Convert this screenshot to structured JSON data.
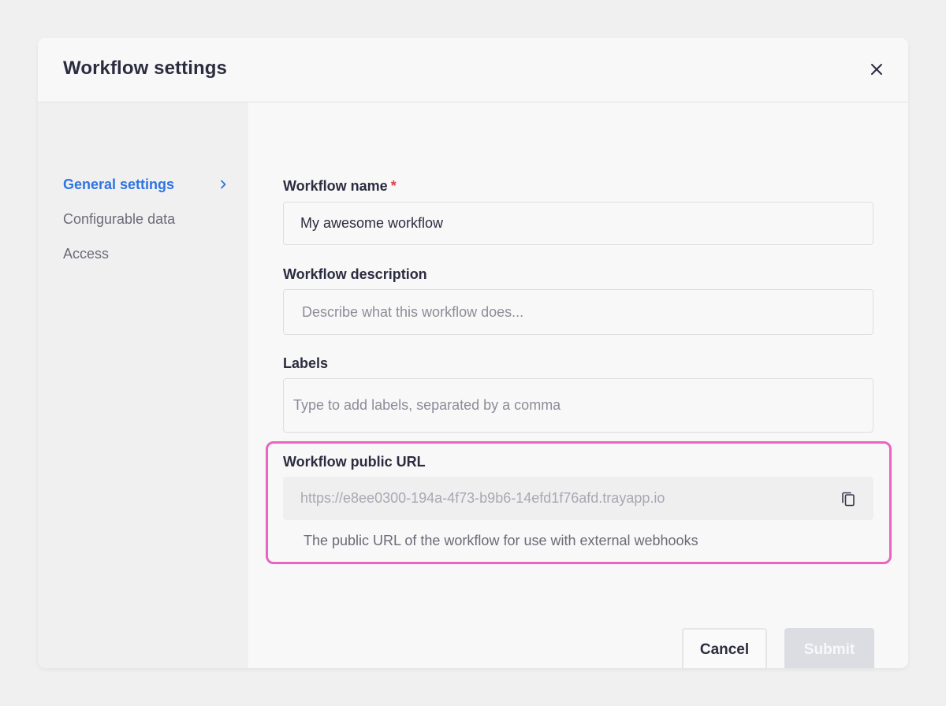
{
  "modal": {
    "title": "Workflow settings"
  },
  "sidebar": {
    "items": [
      {
        "label": "General settings",
        "active": true
      },
      {
        "label": "Configurable data",
        "active": false
      },
      {
        "label": "Access",
        "active": false
      }
    ]
  },
  "form": {
    "name": {
      "label": "Workflow name",
      "required_mark": "*",
      "value": "My awesome workflow"
    },
    "description": {
      "label": "Workflow description",
      "placeholder": "Describe what this workflow does..."
    },
    "labels": {
      "label": "Labels",
      "placeholder": "Type to add labels, separated by a comma"
    },
    "public_url": {
      "label": "Workflow public URL",
      "value": "https://e8ee0300-194a-4f73-b9b6-14efd1f76afd.trayapp.io",
      "helper": "The public URL of the workflow for use with external webhooks"
    }
  },
  "actions": {
    "cancel_label": "Cancel",
    "submit_label": "Submit"
  },
  "colors": {
    "accent": "#2f74e0",
    "required": "#e03e48",
    "highlight": "#e865c3",
    "submit_disabled_bg": "#dcdce3"
  },
  "icons": {
    "close": "close-icon",
    "chevron": "chevron-right-icon",
    "copy": "copy-icon"
  }
}
